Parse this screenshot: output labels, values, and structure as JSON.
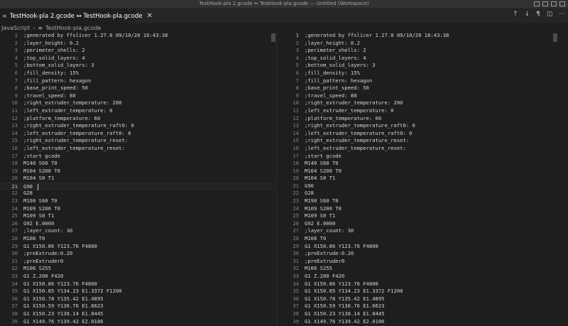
{
  "window": {
    "title": "TestHook-pla 2.gcode ↔ TestHook-pla.gcode — Untitled (Workspace)"
  },
  "tab": {
    "label": "TestHook-pla 2.gcode ↔ TestHook-pla.gcode",
    "close": "✕",
    "icon": "≡"
  },
  "actions": {
    "up": "↑",
    "down": "↓",
    "pilcrow": "¶",
    "split": "◫",
    "more": "···"
  },
  "breadcrumb": {
    "language": "JavaScript",
    "sep": "›",
    "file_icon": "≡",
    "file": "TestHook-pla.gcode"
  },
  "editor": {
    "current_line": 21,
    "lines": [
      ";generated by ffslicer 1.27.0 09/10/20 16:43:38",
      ";layer_height: 0.2",
      ";perimeter_shells: 2",
      ";top_solid_layers: 4",
      ";bottom_solid_layers: 3",
      ";fill_density: 15%",
      ";fill_pattern: hexagon",
      ";base_print_speed: 50",
      ";travel_speed: 80",
      ";right_extruder_temperature: 200",
      ";left_extruder_temperature: 0",
      ";platform_temperature: 60",
      ";right_extruder_temperature_raft0: 0",
      ";left_extruder_temperature_raft0: 0",
      ";right_extruder_temperature_reset:",
      ";left_extruder_temperature_reset:",
      ";start gcode",
      "M140 S60 T0",
      "M104 S200 T0",
      "M104 S0 T1",
      "G90",
      "G28",
      "M190 S60 T0",
      "M109 S200 T0",
      "M109 S0 T1",
      "G92 E.0000",
      ";layer_count: 30",
      "M108 T0",
      "G1 X150.86 Y123.76 F4800",
      ";preExtrude:0.20",
      ";preExtruder0",
      "M106 S255",
      "G1 Z.200 F420",
      "G1 X150.86 Y123.76 F4800",
      "G1 X150.85 Y134.23 E1.3372 F1200",
      "G1 X150.78 Y135.42 E1.4895",
      "G1 X150.59 Y136.76 E1.6623",
      "G1 X150.23 Y138.14 E1.8445",
      "G1 X149.76 Y139.42 E2.0186"
    ]
  }
}
